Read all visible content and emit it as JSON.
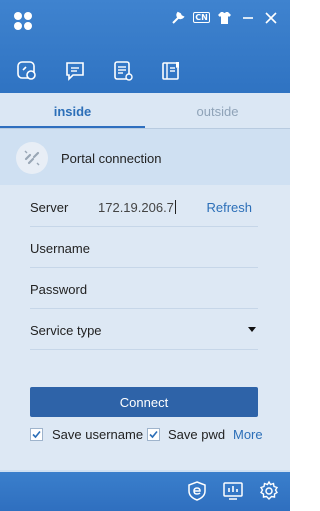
{
  "titlebar": {
    "logo_icon": "app-logo-icon",
    "icons": [
      "tools-icon",
      "language-cn-icon",
      "shirt-skin-icon",
      "minimize-icon",
      "close-icon"
    ],
    "lang_badge": "CN"
  },
  "nav": {
    "icons": [
      "link-connect-icon",
      "message-icon",
      "list-detail-icon",
      "notebook-icon"
    ]
  },
  "tabs": [
    {
      "label": "inside",
      "active": true
    },
    {
      "label": "outside",
      "active": false
    }
  ],
  "portal": {
    "label": "Portal connection"
  },
  "form": {
    "server_label": "Server",
    "server_value": "172.19.206.7",
    "refresh_label": "Refresh",
    "username_label": "Username",
    "password_label": "Password",
    "service_label": "Service type"
  },
  "connect_label": "Connect",
  "options": {
    "save_username_label": "Save username",
    "save_username_checked": true,
    "save_pwd_label": "Save pwd",
    "save_pwd_checked": true,
    "more_label": "More"
  },
  "footer": {
    "icons": [
      "browser-e-icon",
      "monitor-chart-icon",
      "settings-gear-icon"
    ]
  },
  "colors": {
    "header": "#3f83cf",
    "accent": "#2c6fb8",
    "button": "#2e63a8",
    "panel": "#dde8f4"
  }
}
